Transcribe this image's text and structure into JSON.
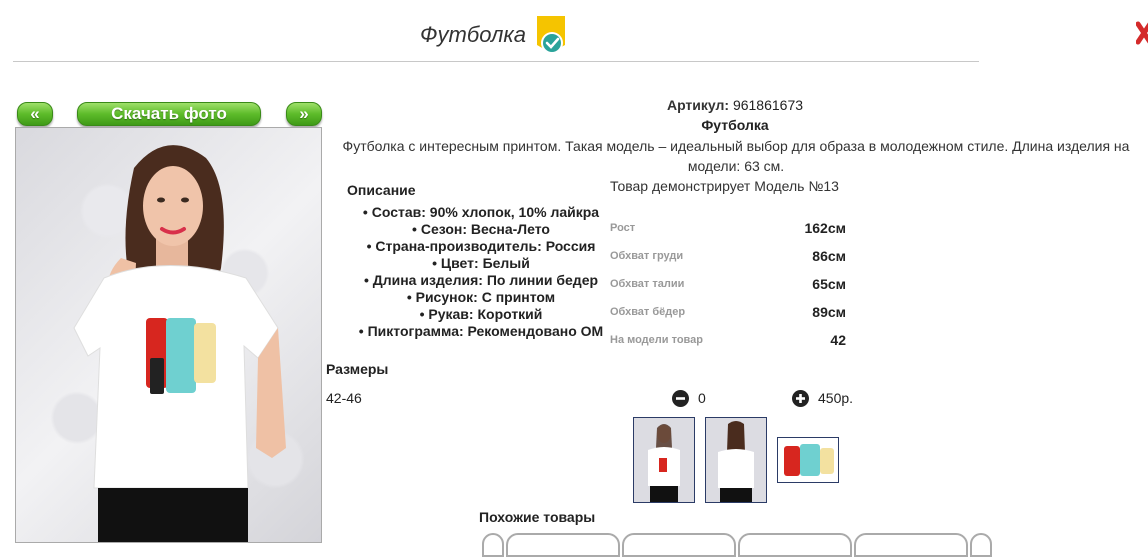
{
  "header": {
    "title": "Футболка"
  },
  "photo_nav": {
    "prev_label": "«",
    "download_label": "Скачать фото",
    "next_label": "»"
  },
  "info": {
    "article_label": "Артикул:",
    "article_value": "961861673",
    "product_name": "Футболка",
    "description": "Футболка с интересным принтом. Такая модель – идеальный выбор для образа в молодежном стиле. Длина изделия на модели: 63 см.",
    "model_note": "Товар демонстрирует Модель №13"
  },
  "description_block": {
    "heading": "Описание",
    "items": [
      "Состав: 90% хлопок, 10% лайкра",
      "Сезон: Весна-Лето",
      "Страна-производитель: Россия",
      "Цвет: Белый",
      "Длина изделия: По линии бедер",
      "Рисунок: С принтом",
      "Рукав: Короткий",
      "Пиктограмма: Рекомендовано ОМ"
    ]
  },
  "measurements": [
    {
      "label": "Рост",
      "value": "162см"
    },
    {
      "label": "Обхват груди",
      "value": "86см"
    },
    {
      "label": "Обхват талии",
      "value": "65см"
    },
    {
      "label": "Обхват бёдер",
      "value": "89см"
    },
    {
      "label": "На модели товар",
      "value": "42"
    }
  ],
  "sizes": {
    "heading": "Размеры",
    "rows": [
      {
        "size": "42-46",
        "quantity": "0",
        "price": "450р."
      }
    ]
  },
  "similar": {
    "heading": "Похожие товары"
  },
  "colors": {
    "accent_green": "#5dbb2a",
    "thumb_border": "#2b3b66",
    "badge_yellow": "#f5c400",
    "badge_teal": "#2aa39a"
  }
}
